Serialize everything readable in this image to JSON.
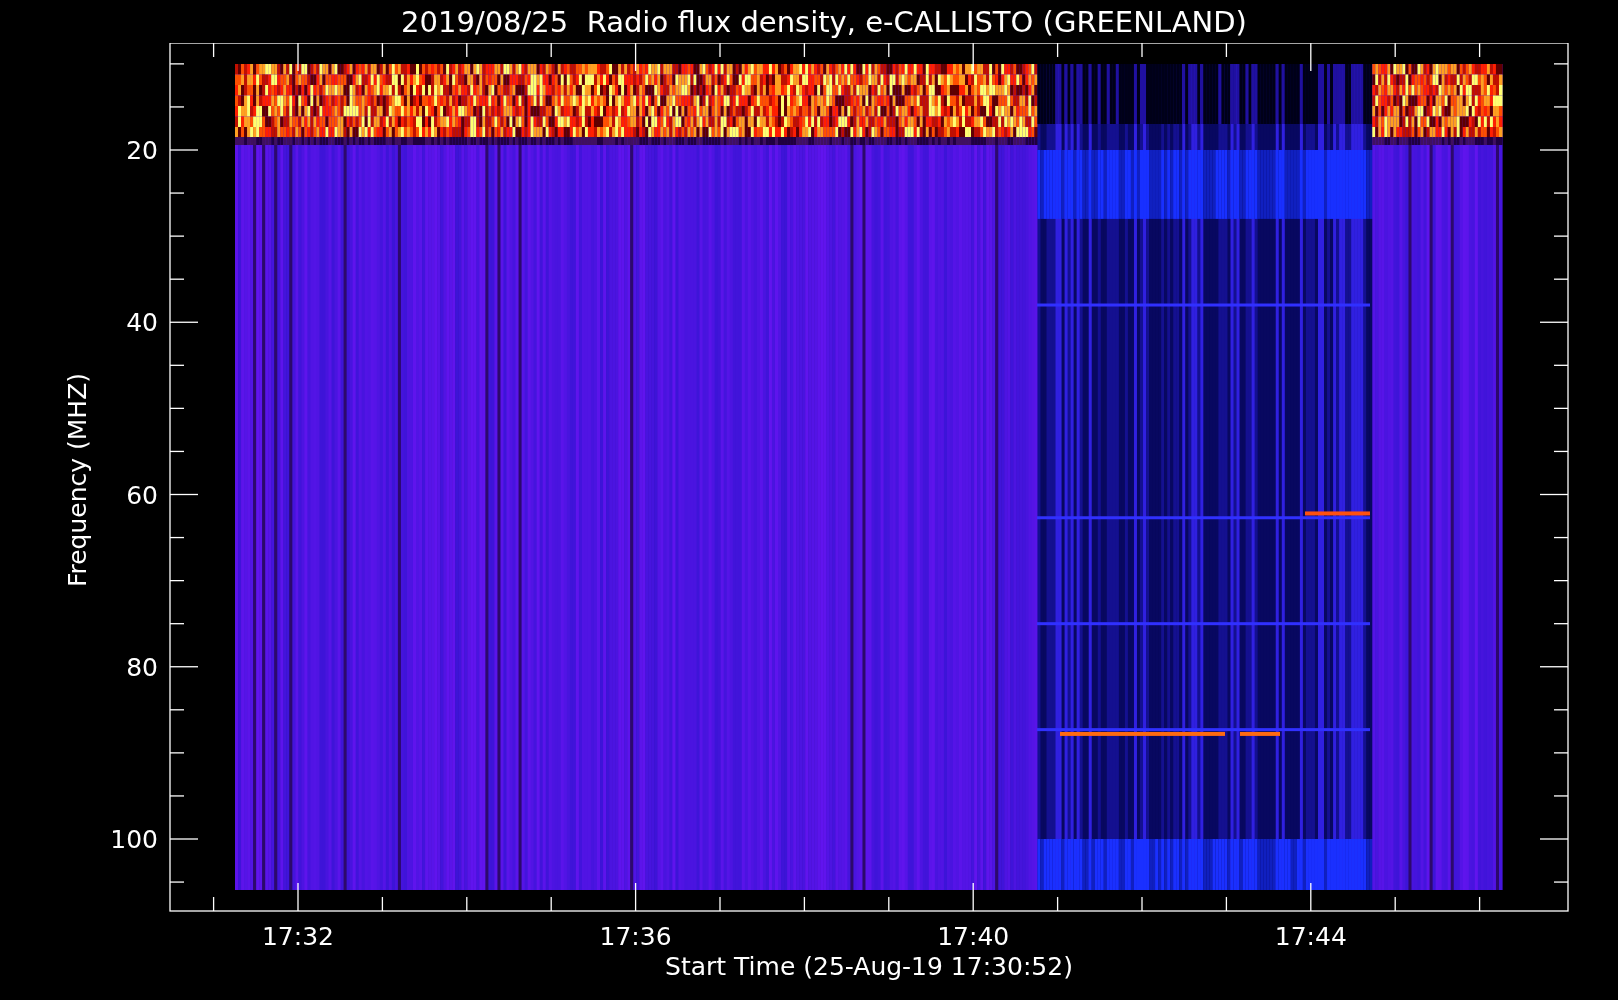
{
  "plot": {
    "title": "2019/08/25  Radio flux density, e-CALLISTO (GREENLAND)",
    "xlabel": "Start Time (25-Aug-19 17:30:52)",
    "ylabel": "Frequency (MHZ)",
    "yticks": [
      "20",
      "40",
      "60",
      "80",
      "100"
    ],
    "xticks": [
      "17:32",
      "17:36",
      "17:40",
      "17:44"
    ]
  }
}
